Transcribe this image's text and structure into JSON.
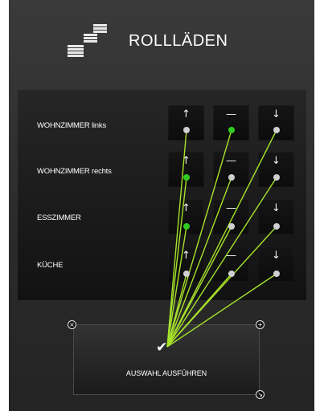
{
  "header": {
    "title": "ROLLLÄDEN",
    "icon": "shutter-stack-icon"
  },
  "rooms": [
    {
      "label": "WOHNZIMMER links"
    },
    {
      "label": "WOHNZIMMER rechts"
    },
    {
      "label": "ESSZIMMER"
    },
    {
      "label": "KÜCHE"
    }
  ],
  "buttons": {
    "up": "↑",
    "stop": "—",
    "down": "↓"
  },
  "execute": {
    "label": "AUSWAHL AUSFÜHREN",
    "check": "✔"
  },
  "handles": {
    "close": "×",
    "add": "+",
    "resize": "↘"
  },
  "colors": {
    "wire": "#a6e22a",
    "selected_dot": "#2ecc1f",
    "dot": "#cfcfcf"
  },
  "selection": {
    "0": {
      "up": false,
      "stop": true,
      "down": false
    },
    "1": {
      "up": true,
      "stop": false,
      "down": false
    },
    "2": {
      "up": true,
      "stop": false,
      "down": false
    },
    "3": {
      "up": false,
      "stop": false,
      "down": false
    }
  }
}
